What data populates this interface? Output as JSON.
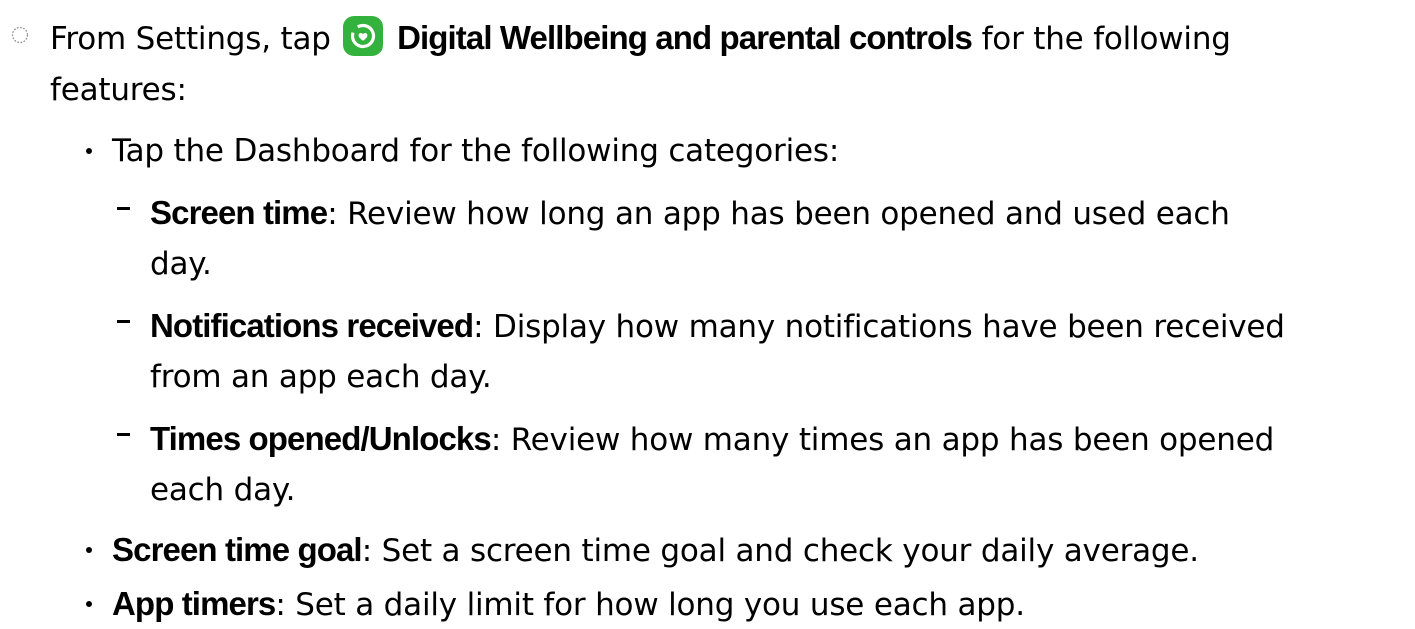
{
  "step": {
    "prefix": "From Settings, tap",
    "app_name": "Digital Wellbeing and parental controls",
    "suffix_line1": " for the following",
    "suffix_line2": "features:",
    "app_icon": "digital-wellbeing-icon"
  },
  "dashboard": {
    "intro": "Tap the Dashboard for the following categories:",
    "categories": [
      {
        "title": "Screen time",
        "line1": ": Review how long an app has been opened and used each",
        "line2": "day."
      },
      {
        "title": "Notifications received",
        "line1": ": Display how many notifications have been received",
        "line2": "from an app each day."
      },
      {
        "title": "Times opened/Unlocks",
        "line1": ": Review how many times an app has been opened",
        "line2": "each day."
      }
    ]
  },
  "features": [
    {
      "title": "Screen time goal",
      "text": ": Set a screen time goal and check your daily average."
    },
    {
      "title": "App timers",
      "text": ": Set a daily limit for how long you use each app."
    }
  ],
  "colors": {
    "text": "#000000",
    "icon_background": "#34b23e",
    "icon_glyph": "#ffffff"
  }
}
